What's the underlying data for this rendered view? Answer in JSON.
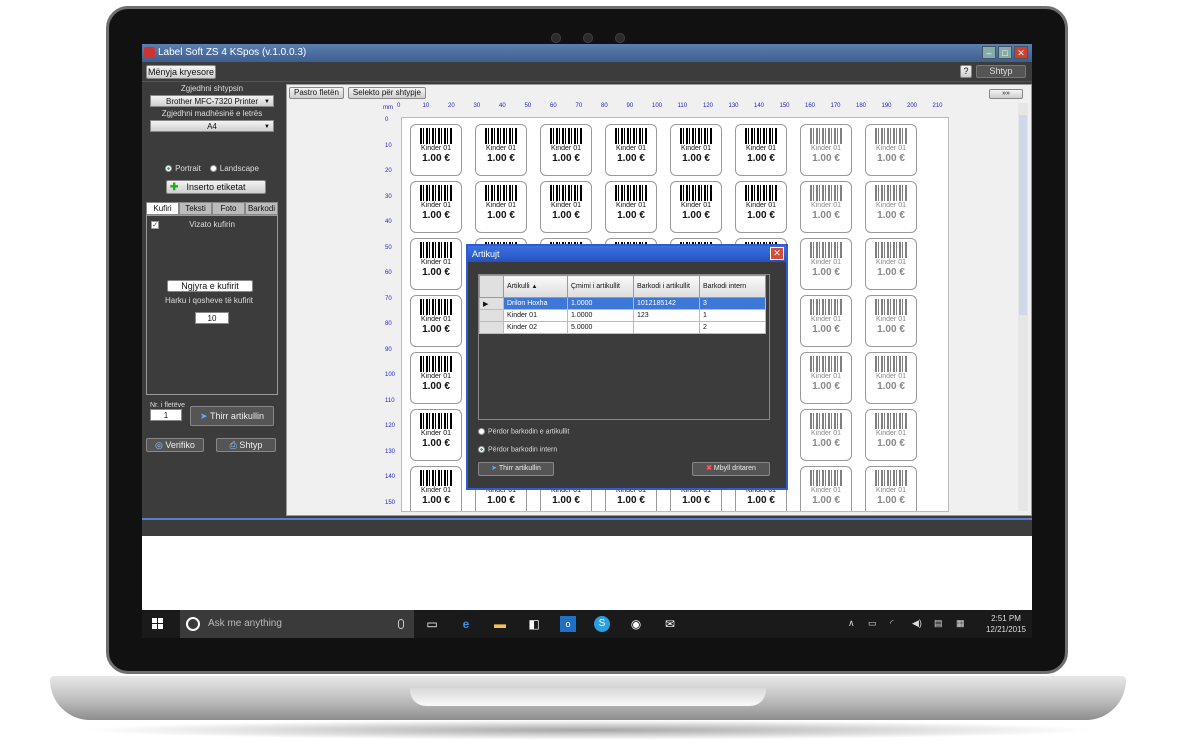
{
  "app": {
    "title": "Label Soft ZS 4 KSpos (v.1.0.0.3)",
    "menu_button": "Mënyja kryesore",
    "help_button": "?",
    "print_top": "Shtyp"
  },
  "left_panel": {
    "printer_label": "Zgjedhni shtypsin",
    "printer_value": "Brother MFC-7320 Printer",
    "paper_label": "Zgjedhni madhësinë e letrës",
    "paper_value": "A4",
    "orientation": {
      "portrait": "Portrait",
      "landscape": "Landscape",
      "selected": "Portrait"
    },
    "insert_labels": "Inserto etiketat",
    "tabs": [
      "Kufiri",
      "Teksti",
      "Foto",
      "Barkodi"
    ],
    "active_tab": "Kufiri",
    "draw_border": "Vizato kufirin",
    "border_color_button": "Ngjyra e kufirit",
    "corner_radius_label": "Harku i qosheve të kufirit",
    "corner_radius_value": "10",
    "copies_label": "Nr. i fletëve",
    "copies_value": "1",
    "select_item_button": "Thirr artikullin",
    "verify_button": "Verifiko",
    "print_button": "Shtyp"
  },
  "canvas": {
    "clear_button": "Pastro fletën",
    "select_page_button": "Selekto për shtypje",
    "corner_button": "»»",
    "ruler_unit": "mm",
    "ruler_top": [
      "0",
      "10",
      "20",
      "30",
      "40",
      "50",
      "60",
      "70",
      "80",
      "90",
      "100",
      "110",
      "120",
      "130",
      "140",
      "150",
      "160",
      "170",
      "180",
      "190",
      "200",
      "210"
    ],
    "ruler_left": [
      "0",
      "10",
      "20",
      "30",
      "40",
      "50",
      "60",
      "70",
      "80",
      "90",
      "100",
      "110",
      "120",
      "130",
      "140",
      "150"
    ],
    "label_name": "Kinder 01",
    "label_price": "1.00 €",
    "label_code": "0"
  },
  "dialog": {
    "title": "Artikujt",
    "columns": [
      "Artikulli",
      "Çmimi i artikullit",
      "Barkodi i artikullit",
      "Barkodi intern"
    ],
    "rows": [
      {
        "name": "Drilon Hoxha",
        "price": "1.0000",
        "barcode": "1012185142",
        "internal": "3",
        "selected": true
      },
      {
        "name": "Kinder 01",
        "price": "1.0000",
        "barcode": "123",
        "internal": "1",
        "selected": false
      },
      {
        "name": "Kinder 02",
        "price": "5.0000",
        "barcode": "",
        "internal": "2",
        "selected": false
      }
    ],
    "option_item_barcode": "Përdor barkodin e artikullit",
    "option_internal_barcode": "Përdor barkodin intern",
    "selected_option": "Përdor barkodin intern",
    "fetch_button": "Thirr artikullin",
    "close_button": "Mbyll dritaren"
  },
  "taskbar": {
    "search_placeholder": "Ask me anything",
    "time": "2:51 PM",
    "date": "12/21/2015",
    "icons": [
      "windows-start-icon",
      "task-view-icon",
      "edge-icon",
      "file-explorer-icon",
      "store-icon",
      "outlook-icon",
      "skype-icon",
      "media-icon",
      "mail-icon"
    ]
  },
  "colors": {
    "app_bg": "#3c3c3c",
    "dialog_title": "#2452c0",
    "selection": "#3d78d8",
    "ruler": "#2222cc"
  }
}
